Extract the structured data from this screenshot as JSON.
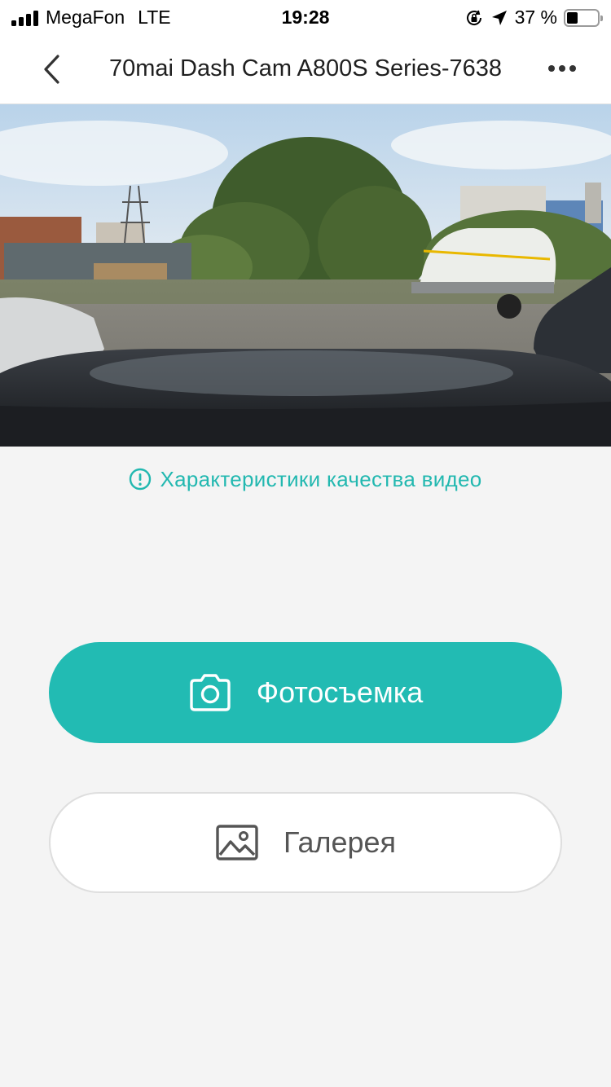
{
  "status_bar": {
    "carrier": "MegaFon",
    "network": "LTE",
    "time": "19:28",
    "battery_percent_text": "37 %",
    "battery_level": 0.37,
    "icons": [
      "signal-icon",
      "orientation-lock-icon",
      "location-arrow-icon",
      "battery-icon"
    ]
  },
  "nav": {
    "title": "70mai Dash Cam A800S Series-7638",
    "back_icon": "chevron-left-icon",
    "more_icon": "more-dots-icon"
  },
  "preview": {
    "description_icon": "camera-feed"
  },
  "quality_link": {
    "label": "Характеристики качества видео",
    "icon": "info-circle-icon",
    "color": "#22b8b0"
  },
  "actions": {
    "photo_label": "Фотосъемка",
    "photo_icon": "camera-icon",
    "gallery_label": "Галерея",
    "gallery_icon": "image-icon"
  },
  "colors": {
    "accent": "#22bbb3",
    "background": "#f4f4f4"
  }
}
